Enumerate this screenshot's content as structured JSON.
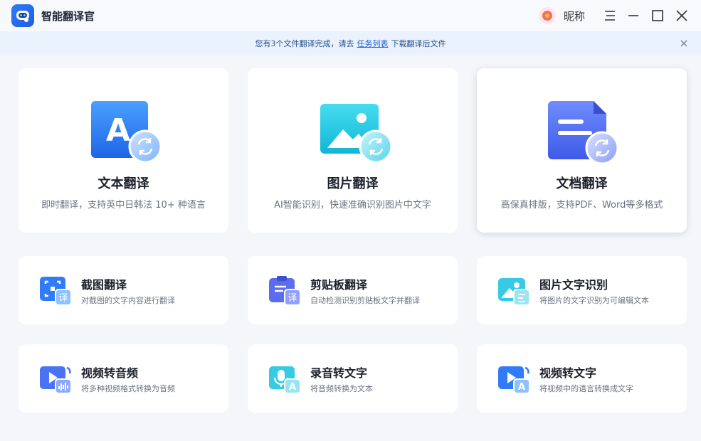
{
  "app": {
    "title": "智能翻译官",
    "user_name": "昵称"
  },
  "notice": {
    "prefix": "您有3个文件翻译完成，请去",
    "link": "任务列表",
    "suffix": "下载翻译后文件"
  },
  "big_cards": [
    {
      "title": "文本翻译",
      "desc": "即时翻译，支持英中日韩法 10+ 种语言",
      "icon": "text-translate-icon",
      "letter": "A"
    },
    {
      "title": "图片翻译",
      "desc": "AI智能识别，快速准确识别图片中文字",
      "icon": "image-translate-icon"
    },
    {
      "title": "文档翻译",
      "desc": "高保真排版，支持PDF、Word等多格式",
      "icon": "document-translate-icon"
    }
  ],
  "small_cards": [
    {
      "title": "截图翻译",
      "desc": "对截图的文字内容进行翻译",
      "icon": "screenshot-translate-icon",
      "badge": "译"
    },
    {
      "title": "剪贴板翻译",
      "desc": "自动检测识别剪贴板文字并翻译",
      "icon": "clipboard-translate-icon",
      "badge": "译"
    },
    {
      "title": "图片文字识别",
      "desc": "将图片的文字识别为可编辑文本",
      "icon": "image-ocr-icon"
    },
    {
      "title": "视频转音频",
      "desc": "将多种视频格式转换为音频",
      "icon": "video-to-audio-icon"
    },
    {
      "title": "录音转文字",
      "desc": "将音频转换为文本",
      "icon": "audio-to-text-icon",
      "badge": "A"
    },
    {
      "title": "视频转文字",
      "desc": "将视频中的语言转换成文字",
      "icon": "video-to-text-icon",
      "badge": "A"
    }
  ],
  "colors": {
    "accent": "#2f7cf6",
    "cyan": "#1fc8e0",
    "indigo": "#5b6cf0"
  }
}
